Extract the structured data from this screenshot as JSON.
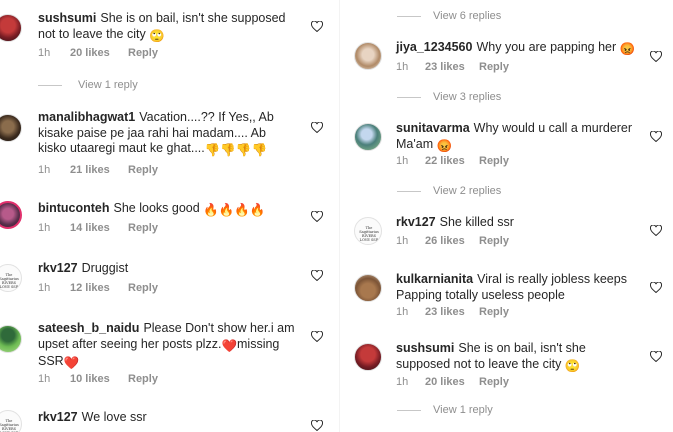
{
  "left_column": {
    "comments": [
      {
        "username": "sushsumi",
        "text": "She is on bail, isn't she supposed not to leave the city",
        "emoji": "🙄",
        "time": "1h",
        "likes": "20 likes",
        "reply": "Reply",
        "avatar_style": "red"
      },
      {
        "view_replies": "View 1 reply"
      },
      {
        "username": "manalibhagwat1",
        "text": "Vacation....?? If Yes,, Ab kisake paise pe jaa rahi hai madam.... Ab kisko utaaregi maut ke ghat....",
        "emoji": "👎👎👎👎",
        "time": "1h",
        "likes": "21 likes",
        "reply": "Reply",
        "avatar_style": "dark"
      },
      {
        "username": "bintuconteh",
        "text": "She looks good",
        "emoji": "🔥🔥🔥🔥",
        "time": "1h",
        "likes": "14 likes",
        "reply": "Reply",
        "avatar_style": "story"
      },
      {
        "username": "rkv127",
        "text": "Druggist",
        "emoji": "",
        "time": "1h",
        "likes": "12 likes",
        "reply": "Reply",
        "avatar_style": "logo"
      },
      {
        "username": "sateesh_b_naidu",
        "text": "Please Don't show her.i am upset after seeing her posts plzz.",
        "emoji": "❤️",
        "text_after": "missing SSR",
        "emoji_after": "❤️",
        "time": "1h",
        "likes": "10 likes",
        "reply": "Reply",
        "avatar_style": "green"
      },
      {
        "username": "rkv127",
        "text": "We love ssr",
        "emoji": "",
        "avatar_style": "logo"
      }
    ]
  },
  "right_column": {
    "comments": [
      {
        "view_replies": "View 6 replies"
      },
      {
        "username": "jiya_1234560",
        "text": "Why you are papping her",
        "emoji": "😡",
        "time": "1h",
        "likes": "23 likes",
        "reply": "Reply",
        "avatar_style": "jiya"
      },
      {
        "view_replies": "View 3 replies"
      },
      {
        "username": "sunitavarma",
        "text": "Why would u call a murderer Ma'am",
        "emoji": "😡",
        "time": "1h",
        "likes": "22 likes",
        "reply": "Reply",
        "avatar_style": "sunita"
      },
      {
        "view_replies": "View 2 replies"
      },
      {
        "username": "rkv127",
        "text": "She killed ssr",
        "emoji": "",
        "time": "1h",
        "likes": "26 likes",
        "reply": "Reply",
        "avatar_style": "logo"
      },
      {
        "username": "kulkarnianita",
        "text": "Viral is really jobless keeps Papping totally useless people",
        "emoji": "",
        "time": "1h",
        "likes": "23 likes",
        "reply": "Reply",
        "avatar_style": "kul"
      },
      {
        "username": "sushsumi",
        "text": "She is on bail, isn't she supposed not to leave the city",
        "emoji": "🙄",
        "time": "1h",
        "likes": "20 likes",
        "reply": "Reply",
        "avatar_style": "red"
      },
      {
        "view_replies": "View 1 reply"
      }
    ]
  },
  "logo_caption": "The Sagittarius RIVERS LOVE SSR"
}
